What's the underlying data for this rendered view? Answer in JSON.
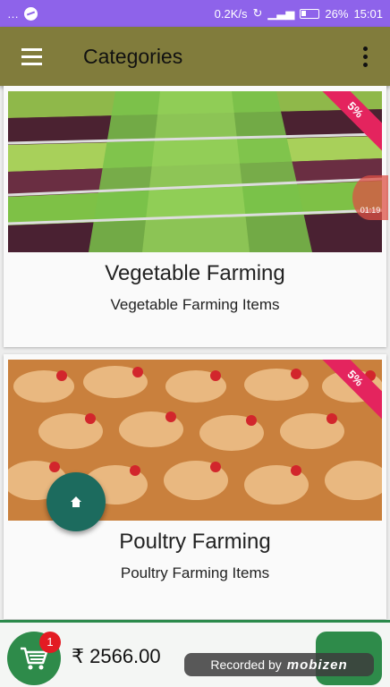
{
  "status_bar": {
    "dots": "…",
    "speed": "0.2K/s",
    "battery": "26%",
    "time": "15:01"
  },
  "app_bar": {
    "title": "Categories"
  },
  "categories": [
    {
      "title": "Vegetable Farming",
      "subtitle": "Vegetable Farming Items",
      "discount": "5%"
    },
    {
      "title": "Poultry Farming",
      "subtitle": "Poultry Farming Items",
      "discount": "5%"
    }
  ],
  "cart": {
    "badge": "1",
    "total": "₹ 2566.00"
  },
  "overlay": {
    "timer": "01:19",
    "recorder_label": "Recorded by",
    "recorder_brand": "mobizen"
  },
  "colors": {
    "status_bar": "#8e63ea",
    "app_bar": "#817c3c",
    "accent_green": "#2e8b4a",
    "ribbon": "#e4245e",
    "fab": "#1c6b5e"
  },
  "icons": [
    "menu-icon",
    "more-vert-icon",
    "home-icon",
    "cart-icon"
  ]
}
